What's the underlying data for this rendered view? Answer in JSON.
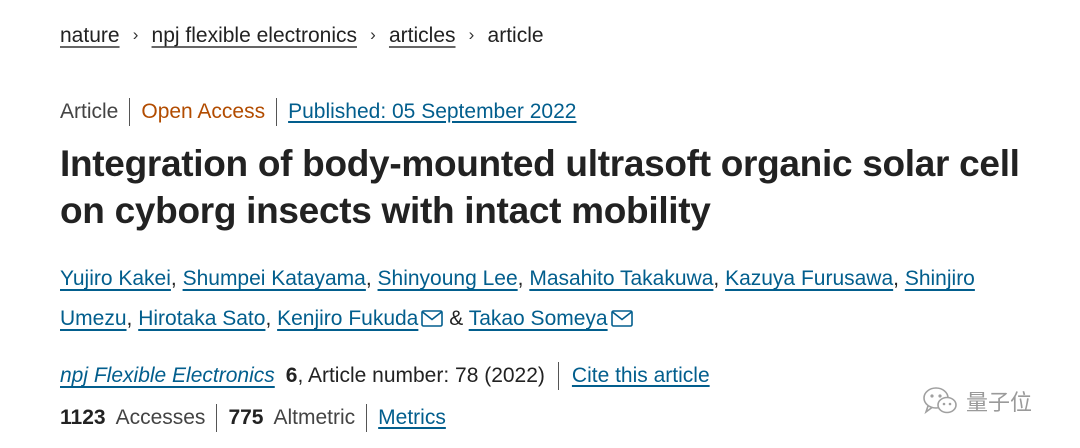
{
  "breadcrumb": {
    "items": [
      "nature",
      "npj flexible electronics",
      "articles"
    ],
    "current": "article",
    "separator": "›"
  },
  "meta": {
    "type": "Article",
    "access": "Open Access",
    "published": "Published: 05 September 2022"
  },
  "title": "Integration of body-mounted ultrasoft organic solar cell on cyborg insects with intact mobility",
  "authors": {
    "list": [
      "Yujiro Kakei",
      "Shumpei Katayama",
      "Shinyoung Lee",
      "Masahito Takakuwa",
      "Kazuya Furusawa",
      "Shinjiro Umezu",
      "Hirotaka Sato",
      "Kenjiro Fukuda",
      "Takao Someya"
    ],
    "and": "&"
  },
  "journal": {
    "name": "npj Flexible Electronics",
    "volume": "6",
    "article_text": ", Article number: 78 (2022)",
    "cite": "Cite this article"
  },
  "metrics": {
    "accesses_count": "1123",
    "accesses_label": "Accesses",
    "altmetric_count": "775",
    "altmetric_label": "Altmetric",
    "link": "Metrics"
  },
  "watermark": {
    "text": "量子位",
    "icon": "wechat-icon"
  },
  "colors": {
    "link": "#025e8d",
    "open_access": "#b24c00",
    "text": "#222222"
  }
}
